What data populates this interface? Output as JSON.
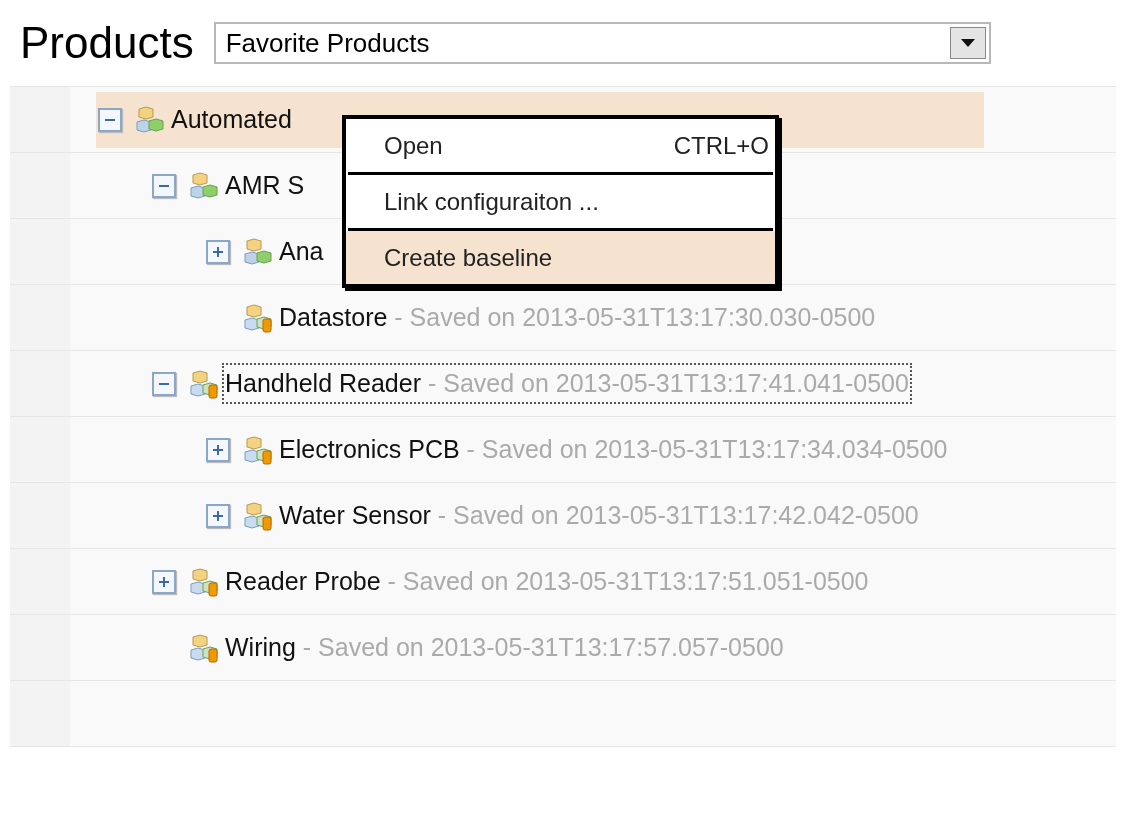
{
  "header": {
    "title": "Products",
    "dropdown": {
      "value": "Favorite Products"
    }
  },
  "tree": [
    {
      "label": "Automated",
      "kind": "assembly",
      "expanded": true,
      "selected": true,
      "focused": false,
      "children": [
        {
          "label": "AMR S",
          "kind": "assembly",
          "expanded": true,
          "selected": false,
          "focused": false,
          "children": [
            {
              "label": "Ana",
              "kind": "assembly",
              "expanded": false,
              "selected": false,
              "focused": false
            },
            {
              "label": "Datastore",
              "saved": "- Saved on 2013-05-31T13:17:30.030-0500",
              "kind": "saved",
              "selected": false,
              "focused": false
            }
          ]
        },
        {
          "label": "Handheld Reader",
          "saved": "- Saved on 2013-05-31T13:17:41.041-0500",
          "kind": "saved",
          "expanded": true,
          "selected": false,
          "focused": true,
          "children": [
            {
              "label": "Electronics PCB",
              "saved": "- Saved on 2013-05-31T13:17:34.034-0500",
              "kind": "saved",
              "expanded": false,
              "selected": false,
              "focused": false
            },
            {
              "label": "Water Sensor",
              "saved": "- Saved on 2013-05-31T13:17:42.042-0500",
              "kind": "saved",
              "expanded": false,
              "selected": false,
              "focused": false
            }
          ]
        },
        {
          "label": "Reader Probe",
          "saved": "- Saved on 2013-05-31T13:17:51.051-0500",
          "kind": "saved",
          "expanded": false,
          "selected": false,
          "focused": false
        },
        {
          "label": "Wiring",
          "saved": "- Saved on 2013-05-31T13:17:57.057-0500",
          "kind": "saved",
          "selected": false,
          "focused": false
        }
      ]
    }
  ],
  "context_menu": [
    {
      "label": "Open",
      "shortcut": "CTRL+O",
      "selected": false
    },
    {
      "label": "Link configuraiton ...",
      "selected": false
    },
    {
      "label": "Create baseline",
      "selected": true
    }
  ]
}
